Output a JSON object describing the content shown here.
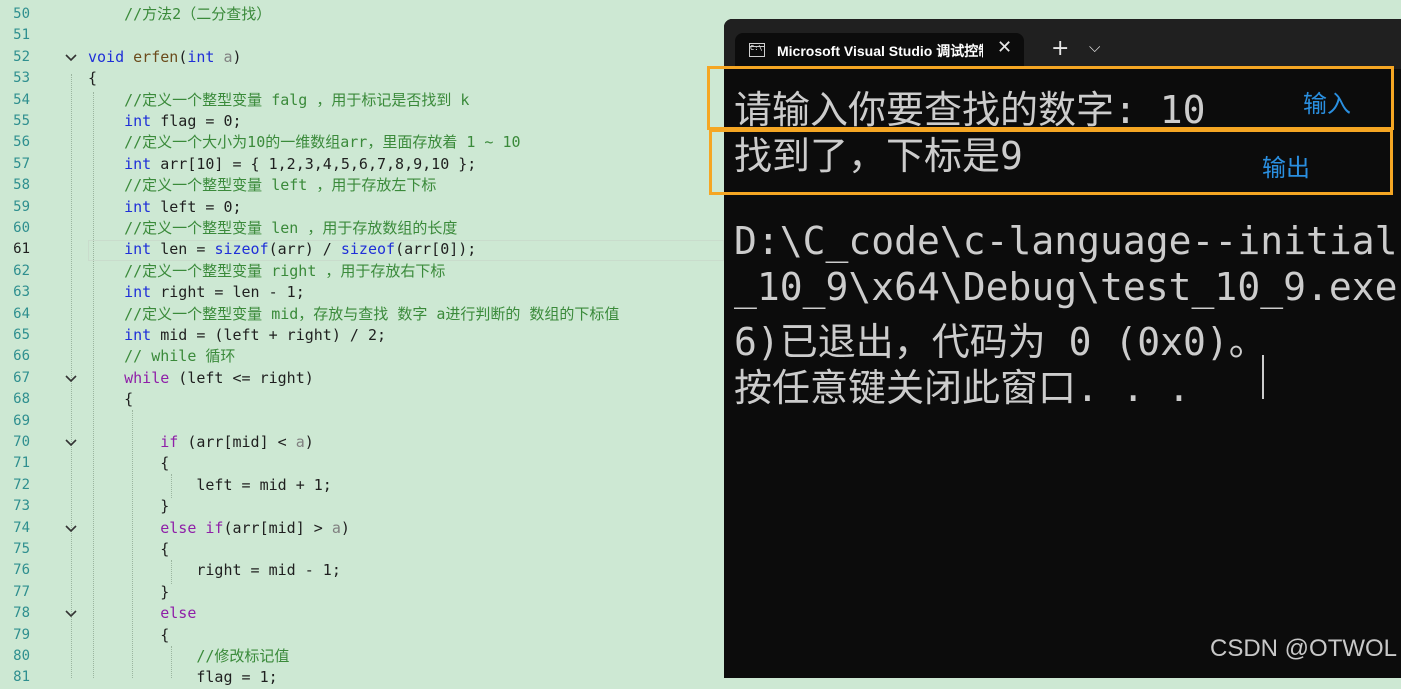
{
  "editor": {
    "lines": [
      {
        "n": "50",
        "fold": "",
        "segs": [
          [
            "    ",
            ""
          ],
          [
            "//方法2（二分查找）",
            "cmt"
          ]
        ]
      },
      {
        "n": "51",
        "fold": "",
        "segs": [
          [
            "",
            ""
          ]
        ]
      },
      {
        "n": "52",
        "fold": "v",
        "segs": [
          [
            "void",
            "kw"
          ],
          [
            " ",
            ""
          ],
          [
            "erfen",
            "fn"
          ],
          [
            "(",
            ""
          ],
          [
            "int",
            "kw"
          ],
          [
            " ",
            ""
          ],
          [
            "a",
            "prm"
          ],
          [
            ")",
            ""
          ]
        ]
      },
      {
        "n": "53",
        "fold": "",
        "segs": [
          [
            "{",
            ""
          ]
        ]
      },
      {
        "n": "54",
        "fold": "",
        "segs": [
          [
            "    ",
            ""
          ],
          [
            "//定义一个整型变量 falg ，用于标记是否找到 k",
            "cmt"
          ]
        ]
      },
      {
        "n": "55",
        "fold": "",
        "segs": [
          [
            "    ",
            ""
          ],
          [
            "int",
            "kw"
          ],
          [
            " flag = 0;",
            ""
          ]
        ]
      },
      {
        "n": "56",
        "fold": "",
        "segs": [
          [
            "    ",
            ""
          ],
          [
            "//定义一个大小为10的一维数组arr，里面存放着 1 ~ 10",
            "cmt"
          ]
        ]
      },
      {
        "n": "57",
        "fold": "",
        "segs": [
          [
            "    ",
            ""
          ],
          [
            "int",
            "kw"
          ],
          [
            " arr[10] = { 1,2,3,4,5,6,7,8,9,10 };",
            ""
          ]
        ]
      },
      {
        "n": "58",
        "fold": "",
        "segs": [
          [
            "    ",
            ""
          ],
          [
            "//定义一个整型变量 left ，用于存放左下标",
            "cmt"
          ]
        ]
      },
      {
        "n": "59",
        "fold": "",
        "segs": [
          [
            "    ",
            ""
          ],
          [
            "int",
            "kw"
          ],
          [
            " left = 0;",
            ""
          ]
        ]
      },
      {
        "n": "60",
        "fold": "",
        "segs": [
          [
            "    ",
            ""
          ],
          [
            "//定义一个整型变量 len ，用于存放数组的长度",
            "cmt"
          ]
        ]
      },
      {
        "n": "61",
        "fold": "",
        "active": true,
        "segs": [
          [
            "    ",
            ""
          ],
          [
            "int",
            "kw"
          ],
          [
            " len = ",
            ""
          ],
          [
            "sizeof",
            "kw"
          ],
          [
            "(arr) / ",
            ""
          ],
          [
            "sizeof",
            "kw"
          ],
          [
            "(arr[0]);",
            ""
          ]
        ]
      },
      {
        "n": "62",
        "fold": "",
        "segs": [
          [
            "    ",
            ""
          ],
          [
            "//定义一个整型变量 right ，用于存放右下标",
            "cmt"
          ]
        ]
      },
      {
        "n": "63",
        "fold": "",
        "segs": [
          [
            "    ",
            ""
          ],
          [
            "int",
            "kw"
          ],
          [
            " right = len - 1;",
            ""
          ]
        ]
      },
      {
        "n": "64",
        "fold": "",
        "segs": [
          [
            "    ",
            ""
          ],
          [
            "//定义一个整型变量 mid，存放与查找 数字 a进行判断的 数组的下标值",
            "cmt"
          ]
        ]
      },
      {
        "n": "65",
        "fold": "",
        "segs": [
          [
            "    ",
            ""
          ],
          [
            "int",
            "kw"
          ],
          [
            " mid = (left + right) / 2;",
            ""
          ]
        ]
      },
      {
        "n": "66",
        "fold": "",
        "segs": [
          [
            "    ",
            ""
          ],
          [
            "// while 循环",
            "cmt"
          ]
        ]
      },
      {
        "n": "67",
        "fold": "v",
        "segs": [
          [
            "    ",
            ""
          ],
          [
            "while",
            "kw2"
          ],
          [
            " (left <= right)",
            ""
          ]
        ]
      },
      {
        "n": "68",
        "fold": "",
        "segs": [
          [
            "    {",
            ""
          ]
        ]
      },
      {
        "n": "69",
        "fold": "",
        "segs": [
          [
            "",
            ""
          ]
        ]
      },
      {
        "n": "70",
        "fold": "v",
        "segs": [
          [
            "        ",
            ""
          ],
          [
            "if",
            "kw2"
          ],
          [
            " (arr[mid] < ",
            ""
          ],
          [
            "a",
            "prm"
          ],
          [
            ")",
            ""
          ]
        ]
      },
      {
        "n": "71",
        "fold": "",
        "segs": [
          [
            "        {",
            ""
          ]
        ]
      },
      {
        "n": "72",
        "fold": "",
        "segs": [
          [
            "            left = mid + 1;",
            ""
          ]
        ]
      },
      {
        "n": "73",
        "fold": "",
        "segs": [
          [
            "        }",
            ""
          ]
        ]
      },
      {
        "n": "74",
        "fold": "v",
        "segs": [
          [
            "        ",
            ""
          ],
          [
            "else",
            "kw2"
          ],
          [
            " ",
            ""
          ],
          [
            "if",
            "kw2"
          ],
          [
            "(arr[mid] > ",
            ""
          ],
          [
            "a",
            "prm"
          ],
          [
            ")",
            ""
          ]
        ]
      },
      {
        "n": "75",
        "fold": "",
        "segs": [
          [
            "        {",
            ""
          ]
        ]
      },
      {
        "n": "76",
        "fold": "",
        "segs": [
          [
            "            right = mid - 1;",
            ""
          ]
        ]
      },
      {
        "n": "77",
        "fold": "",
        "segs": [
          [
            "        }",
            ""
          ]
        ]
      },
      {
        "n": "78",
        "fold": "v",
        "segs": [
          [
            "        ",
            ""
          ],
          [
            "else",
            "kw2"
          ]
        ]
      },
      {
        "n": "79",
        "fold": "",
        "segs": [
          [
            "        {",
            ""
          ]
        ]
      },
      {
        "n": "80",
        "fold": "",
        "segs": [
          [
            "            ",
            ""
          ],
          [
            "//修改标记值",
            "cmt"
          ]
        ]
      },
      {
        "n": "81",
        "fold": "",
        "segs": [
          [
            "            flag = 1;",
            ""
          ]
        ]
      }
    ]
  },
  "console": {
    "tab_title": "Microsoft Visual Studio 调试控制台",
    "tab_icon_text": "C:\\",
    "close_glyph": "✕",
    "new_tab_glyph": "+",
    "dropdown_glyph": "⌵",
    "lines": [
      "请输入你要查找的数字: 10",
      "找到了，下标是9",
      "",
      "D:\\C_code\\c-language--initial",
      "_10_9\\x64\\Debug\\test_10_9.exe",
      "6)已退出，代码为 0 (0x0)。",
      "按任意键关闭此窗口. . ."
    ]
  },
  "annotations": {
    "input_label": "输入",
    "output_label": "输出",
    "highlight_color": "#f5a623",
    "label_color": "#2a8fe0"
  },
  "watermark": "CSDN @OTWOL",
  "colors": {
    "editor_bg": "#cde8d3",
    "console_bg": "#0c0c0c",
    "comment": "#3a8a3a",
    "keyword": "#1f2fd8",
    "control_keyword": "#8f1fa8"
  }
}
